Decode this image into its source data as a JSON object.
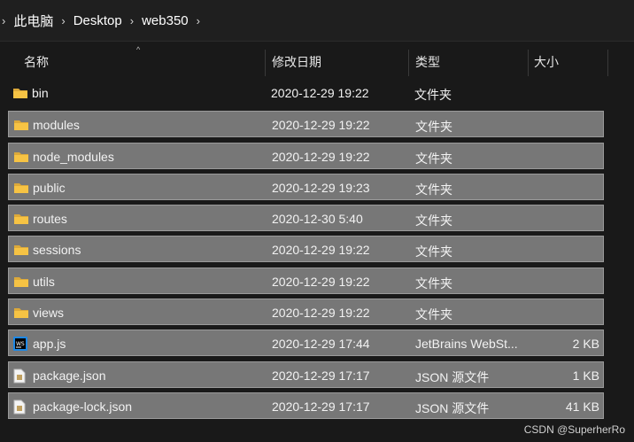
{
  "breadcrumb": {
    "items": [
      "此电脑",
      "Desktop",
      "web350"
    ],
    "separator": "›"
  },
  "columns": {
    "name": "名称",
    "date": "修改日期",
    "type": "类型",
    "size": "大小",
    "sort_indicator": "^"
  },
  "files": [
    {
      "name": "bin",
      "date": "2020-12-29 19:22",
      "type": "文件夹",
      "size": "",
      "icon": "folder-icon",
      "selected": false
    },
    {
      "name": "modules",
      "date": "2020-12-29 19:22",
      "type": "文件夹",
      "size": "",
      "icon": "folder-icon",
      "selected": true
    },
    {
      "name": "node_modules",
      "date": "2020-12-29 19:22",
      "type": "文件夹",
      "size": "",
      "icon": "folder-icon",
      "selected": true
    },
    {
      "name": "public",
      "date": "2020-12-29 19:23",
      "type": "文件夹",
      "size": "",
      "icon": "folder-icon",
      "selected": true
    },
    {
      "name": "routes",
      "date": "2020-12-30 5:40",
      "type": "文件夹",
      "size": "",
      "icon": "folder-icon",
      "selected": true
    },
    {
      "name": "sessions",
      "date": "2020-12-29 19:22",
      "type": "文件夹",
      "size": "",
      "icon": "folder-icon",
      "selected": true
    },
    {
      "name": "utils",
      "date": "2020-12-29 19:22",
      "type": "文件夹",
      "size": "",
      "icon": "folder-icon",
      "selected": true
    },
    {
      "name": "views",
      "date": "2020-12-29 19:22",
      "type": "文件夹",
      "size": "",
      "icon": "folder-icon",
      "selected": true
    },
    {
      "name": "app.js",
      "date": "2020-12-29 17:44",
      "type": "JetBrains WebSt...",
      "size": "2 KB",
      "icon": "webstorm-file-icon",
      "selected": true
    },
    {
      "name": "package.json",
      "date": "2020-12-29 17:17",
      "type": "JSON 源文件",
      "size": "1 KB",
      "icon": "json-file-icon",
      "selected": true
    },
    {
      "name": "package-lock.json",
      "date": "2020-12-29 17:17",
      "type": "JSON 源文件",
      "size": "41 KB",
      "icon": "json-file-icon",
      "selected": true
    }
  ],
  "watermark": "CSDN @SuperherRo",
  "colors": {
    "background": "#191919",
    "selected_row": "#777777",
    "folder": "#f6c344"
  }
}
